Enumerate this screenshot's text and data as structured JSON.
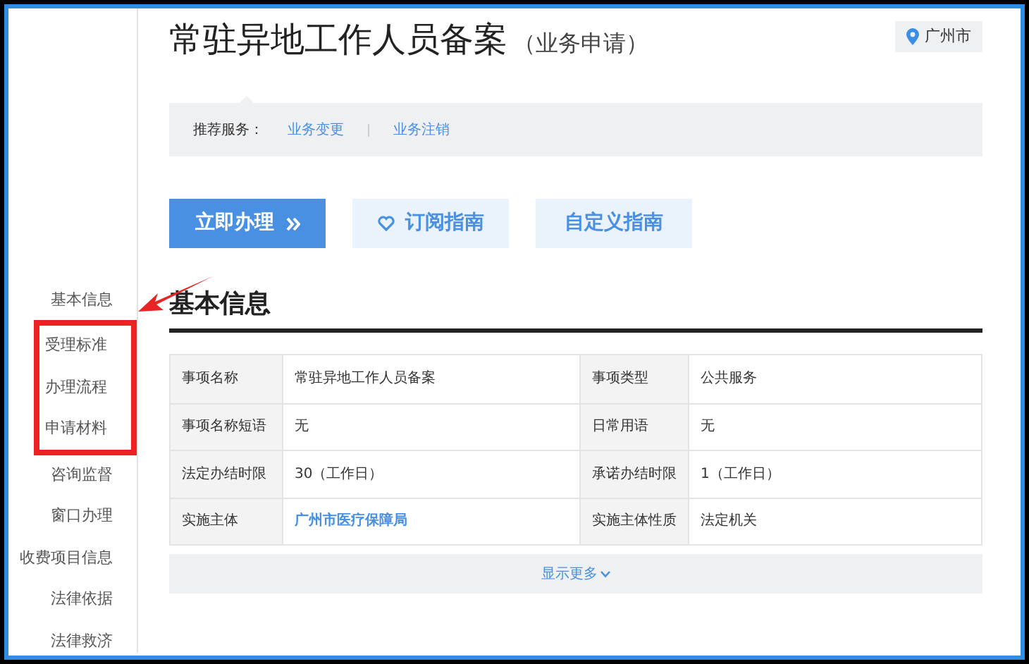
{
  "header": {
    "title": "常驻异地工作人员备案",
    "subtitle": "（业务申请）",
    "location": "广州市"
  },
  "recommend": {
    "label": "推荐服务：",
    "links": [
      "业务变更",
      "业务注销"
    ]
  },
  "actions": [
    {
      "label": "立即办理",
      "kind": "primary"
    },
    {
      "label": "订阅指南",
      "kind": "subscribe"
    },
    {
      "label": "自定义指南",
      "kind": "plain"
    }
  ],
  "sidebar": {
    "items": [
      {
        "label": "基本信息",
        "highlighted": false
      },
      {
        "label": "受理标准",
        "highlighted": true
      },
      {
        "label": "办理流程",
        "highlighted": true
      },
      {
        "label": "申请材料",
        "highlighted": true
      },
      {
        "label": "咨询监督",
        "highlighted": false
      },
      {
        "label": "窗口办理",
        "highlighted": false
      },
      {
        "label": "收费项目信息",
        "highlighted": false
      },
      {
        "label": "法律依据",
        "highlighted": false
      },
      {
        "label": "法律救济",
        "highlighted": false
      }
    ]
  },
  "section": {
    "title": "基本信息"
  },
  "table": {
    "rows": [
      [
        {
          "label": "事项名称",
          "value": "常驻异地工作人员备案",
          "kind": "text"
        },
        {
          "label": "事项类型",
          "value": "公共服务",
          "kind": "text"
        }
      ],
      [
        {
          "label": "事项名称短语",
          "value": "无",
          "kind": "text"
        },
        {
          "label": "日常用语",
          "value": "无",
          "kind": "text"
        }
      ],
      [
        {
          "label": "法定办结时限",
          "value": "30（工作日）",
          "kind": "text"
        },
        {
          "label": "承诺办结时限",
          "value": "1（工作日）",
          "kind": "text"
        }
      ],
      [
        {
          "label": "实施主体",
          "value": "广州市医疗保障局",
          "kind": "link"
        },
        {
          "label": "实施主体性质",
          "value": "法定机关",
          "kind": "text"
        }
      ]
    ]
  },
  "show_more": "显示更多"
}
